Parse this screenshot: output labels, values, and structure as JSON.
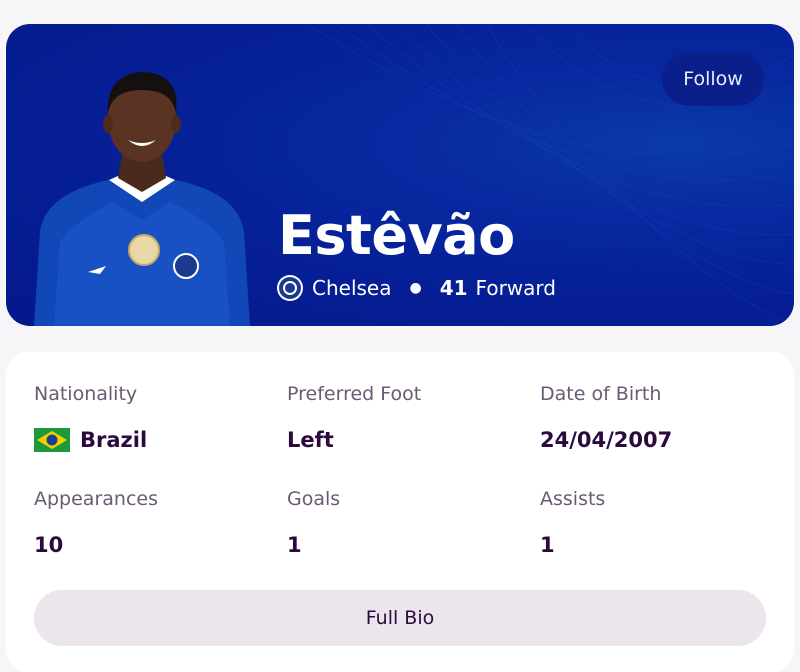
{
  "header": {
    "follow_label": "Follow",
    "player_name": "Estêvão",
    "club": "Chelsea",
    "shirt_number": "41",
    "position": "Forward"
  },
  "details": {
    "nationality_label": "Nationality",
    "nationality_value": "Brazil",
    "foot_label": "Preferred Foot",
    "foot_value": "Left",
    "dob_label": "Date of Birth",
    "dob_value": "24/04/2007",
    "appearances_label": "Appearances",
    "appearances_value": "10",
    "goals_label": "Goals",
    "goals_value": "1",
    "assists_label": "Assists",
    "assists_value": "1"
  },
  "bio_button_label": "Full Bio",
  "colors": {
    "hero_bg": "#061f96",
    "text_dark": "#2b0a3d",
    "label_muted": "#6b5a72",
    "bio_button_bg": "#ece5ec"
  }
}
